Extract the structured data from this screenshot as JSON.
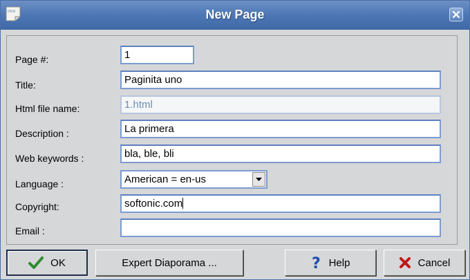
{
  "window": {
    "title": "New Page",
    "app_icon": "notepad-icon"
  },
  "form": {
    "page_num": {
      "label": "Page #:",
      "value": "1"
    },
    "title": {
      "label": "Title:",
      "value": "Paginita uno"
    },
    "html_file": {
      "label": "Html file name:",
      "value": "1.html",
      "enabled": false
    },
    "description": {
      "label": "Description :",
      "value": "La primera"
    },
    "keywords": {
      "label": "Web keywords :",
      "value": "bla, ble, bli"
    },
    "language": {
      "label": "Language :",
      "value": "American = en-us"
    },
    "copyright": {
      "label": "Copyright:",
      "value": "softonic.com"
    },
    "email": {
      "label": "Email :",
      "value": ""
    }
  },
  "buttons": {
    "ok": "OK",
    "expert": "Expert Diaporama ...",
    "help": "Help",
    "cancel": "Cancel"
  },
  "colors": {
    "titlebar": "#4f79b6",
    "field_border": "#7c9bd0",
    "ok_check": "#2e8b2e",
    "help_q": "#1f4fa8",
    "cancel_x": "#c01818"
  }
}
